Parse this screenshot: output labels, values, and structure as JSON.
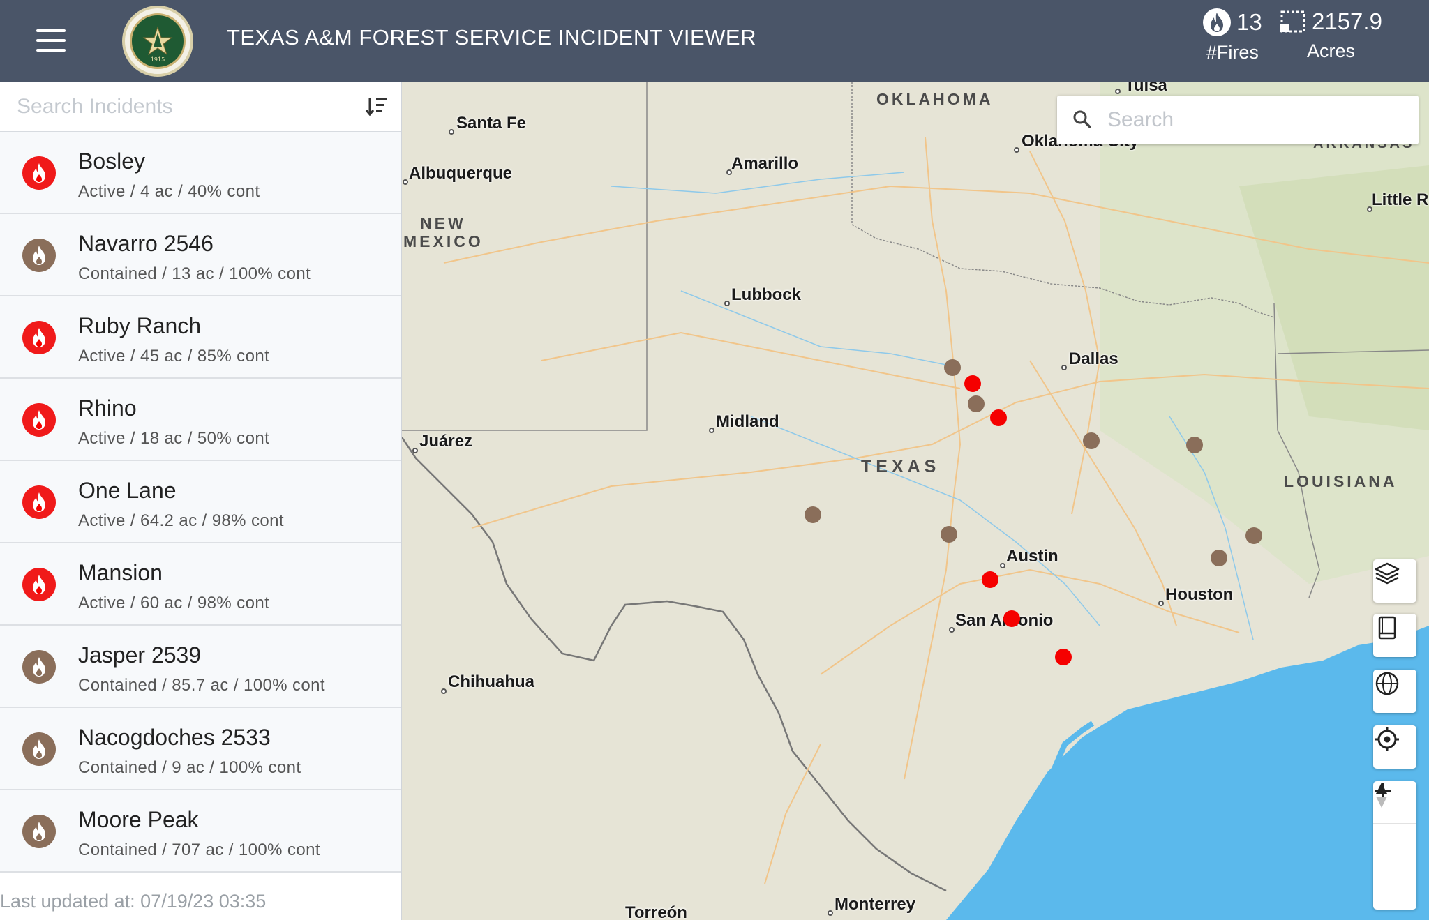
{
  "header": {
    "title": "TEXAS A&M FOREST SERVICE INCIDENT VIEWER",
    "fires_count": "13",
    "fires_label": "#Fires",
    "acres_value": "2157.9",
    "acres_label": "Acres",
    "logo_year": "1915"
  },
  "sidebar": {
    "search_placeholder": "Search Incidents",
    "incidents": [
      {
        "name": "Bosley",
        "meta": "Active / 4 ac / 40% cont",
        "status": "active"
      },
      {
        "name": "Navarro 2546",
        "meta": "Contained / 13 ac / 100% cont",
        "status": "contained"
      },
      {
        "name": "Ruby Ranch",
        "meta": "Active / 45 ac / 85% cont",
        "status": "active"
      },
      {
        "name": "Rhino",
        "meta": "Active / 18 ac / 50% cont",
        "status": "active"
      },
      {
        "name": "One Lane",
        "meta": "Active / 64.2 ac / 98% cont",
        "status": "active"
      },
      {
        "name": "Mansion",
        "meta": "Active / 60 ac / 98% cont",
        "status": "active"
      },
      {
        "name": "Jasper 2539",
        "meta": "Contained / 85.7 ac / 100% cont",
        "status": "contained"
      },
      {
        "name": "Nacogdoches 2533",
        "meta": "Contained / 9 ac / 100% cont",
        "status": "contained"
      },
      {
        "name": "Moore Peak",
        "meta": "Contained / 707 ac / 100% cont",
        "status": "contained"
      }
    ],
    "last_updated": "Last updated at: 07/19/23 03:35"
  },
  "map": {
    "search_placeholder": "Search",
    "regions": [
      "OKLAHOMA",
      "NEW",
      "MEXICO",
      "TEXAS",
      "LOUISIANA",
      "ARKANSAS"
    ],
    "cities": [
      "Tulsa",
      "Santa Fe",
      "Albuquerque",
      "Amarillo",
      "Oklahoma City",
      "Little Rock",
      "Lubbock",
      "Dallas",
      "Midland",
      "Juárez",
      "Austin",
      "Houston",
      "San Antonio",
      "Chihuahua",
      "Torreón",
      "Monterrey"
    ],
    "colors": {
      "active": "#f50000",
      "contained": "#8a6e5a",
      "water": "#5bb9ec",
      "land": "#e6e4d6"
    }
  }
}
